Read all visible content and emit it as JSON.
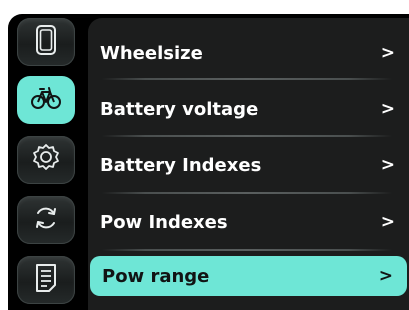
{
  "colors": {
    "accent": "#6ee6d6",
    "background": "#000000",
    "panel": "#1c1d1d",
    "text": "#ffffff"
  },
  "sidebar": {
    "items": [
      {
        "icon": "display-icon",
        "active": false
      },
      {
        "icon": "bicycle-icon",
        "active": true
      },
      {
        "icon": "gear-icon",
        "active": false
      },
      {
        "icon": "refresh-icon",
        "active": false
      },
      {
        "icon": "document-icon",
        "active": false
      }
    ]
  },
  "menu": {
    "items": [
      {
        "label": "Wheelsize",
        "chevron": ">"
      },
      {
        "label": "Battery voltage",
        "chevron": ">"
      },
      {
        "label": "Battery Indexes",
        "chevron": ">"
      },
      {
        "label": "Pow Indexes",
        "chevron": ">"
      },
      {
        "label": "Pow range",
        "chevron": ">",
        "selected": true
      }
    ]
  }
}
